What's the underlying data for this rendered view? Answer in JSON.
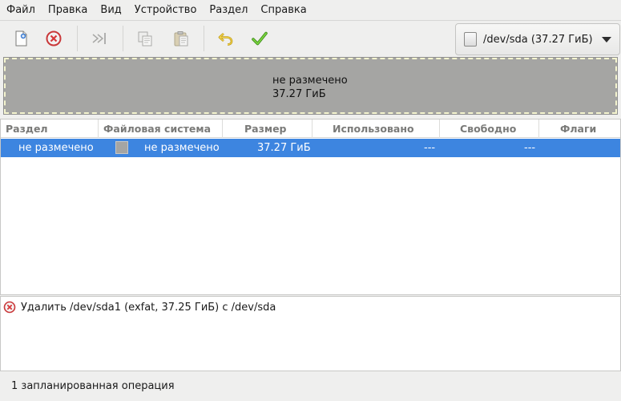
{
  "menubar": {
    "items": [
      "Файл",
      "Правка",
      "Вид",
      "Устройство",
      "Раздел",
      "Справка"
    ]
  },
  "toolbar": {
    "buttons": [
      {
        "name": "new-partition",
        "icon": "new-document-icon",
        "enabled": true
      },
      {
        "name": "delete-partition",
        "icon": "delete-circle-icon",
        "enabled": true
      },
      {
        "name": "resize-move",
        "icon": "resize-arrow-icon",
        "enabled": false
      },
      {
        "name": "copy",
        "icon": "copy-icon",
        "enabled": false
      },
      {
        "name": "paste",
        "icon": "paste-icon",
        "enabled": false
      },
      {
        "name": "undo",
        "icon": "undo-arrow-icon",
        "enabled": true
      },
      {
        "name": "apply",
        "icon": "checkmark-icon",
        "enabled": true
      }
    ],
    "device_selector": "/dev/sda (37.27 ГиБ)"
  },
  "partition_visual": {
    "label": "не размечено",
    "size": "37.27 ГиБ"
  },
  "table": {
    "columns": [
      "Раздел",
      "Файловая система",
      "Размер",
      "Использовано",
      "Свободно",
      "Флаги"
    ],
    "rows": [
      {
        "partition": "не размечено",
        "filesystem": "не размечено",
        "size": "37.27 ГиБ",
        "used": "---",
        "free": "---",
        "flags": "",
        "selected": true
      }
    ]
  },
  "operations": [
    {
      "icon": "delete-circle-icon",
      "text": "Удалить /dev/sda1 (exfat, 37.25 ГиБ) с /dev/sda"
    }
  ],
  "status": "1 запланированная операция",
  "colors": {
    "selection": "#3d85e0",
    "unallocated": "#a5a5a3",
    "delete_red": "#d6383a",
    "apply_green": "#5ab82c",
    "undo_yellow": "#d7b020"
  }
}
